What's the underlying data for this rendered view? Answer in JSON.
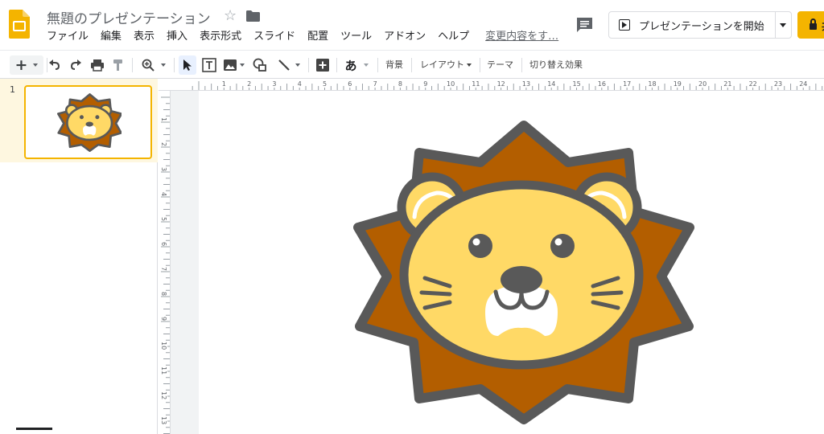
{
  "app": {
    "doc_title": "無題のプレゼンテーション",
    "icons": {
      "logo": "slides-logo-icon",
      "star": "star-icon",
      "folder": "folder-icon",
      "comment": "comment-icon"
    }
  },
  "menu": [
    "ファイル",
    "編集",
    "表示",
    "挿入",
    "表示形式",
    "スライド",
    "配置",
    "ツール",
    "アドオン",
    "ヘルプ"
  ],
  "last_edit": "変更内容をす…",
  "header": {
    "present_label": "プレゼンテーションを開始",
    "share_label": "共",
    "accent_color": "#f4b400"
  },
  "toolbar": {
    "font_text": "あ",
    "background": "背景",
    "layout": "レイアウト",
    "theme": "テーマ",
    "transition": "切り替え効果"
  },
  "filmstrip": {
    "slides": [
      {
        "number": "1"
      }
    ]
  },
  "rulers": {
    "horizontal": [
      "1",
      "2",
      "3",
      "4",
      "5",
      "6",
      "7",
      "8",
      "9",
      "10",
      "11",
      "12",
      "13",
      "14",
      "15",
      "16",
      "17",
      "18",
      "19",
      "20",
      "21",
      "22",
      "23",
      "24"
    ],
    "vertical": [
      "1",
      "2",
      "3",
      "4",
      "5",
      "6",
      "7",
      "8",
      "9",
      "10",
      "11",
      "12",
      "13"
    ]
  },
  "colors": {
    "mane": "#b35e00",
    "face": "#ffd966",
    "outline": "#595959",
    "muzzle": "#ffffff"
  }
}
